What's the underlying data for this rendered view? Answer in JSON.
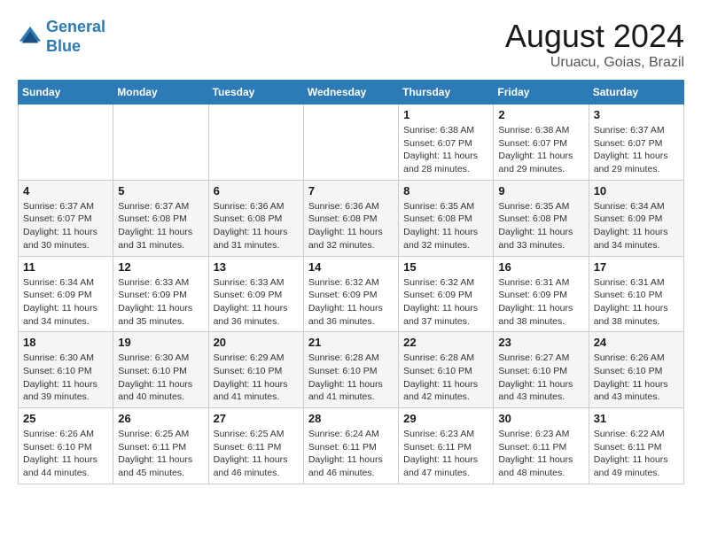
{
  "header": {
    "logo_line1": "General",
    "logo_line2": "Blue",
    "month_title": "August 2024",
    "subtitle": "Uruacu, Goias, Brazil"
  },
  "weekdays": [
    "Sunday",
    "Monday",
    "Tuesday",
    "Wednesday",
    "Thursday",
    "Friday",
    "Saturday"
  ],
  "weeks": [
    [
      {
        "day": "",
        "info": ""
      },
      {
        "day": "",
        "info": ""
      },
      {
        "day": "",
        "info": ""
      },
      {
        "day": "",
        "info": ""
      },
      {
        "day": "1",
        "info": "Sunrise: 6:38 AM\nSunset: 6:07 PM\nDaylight: 11 hours and 28 minutes."
      },
      {
        "day": "2",
        "info": "Sunrise: 6:38 AM\nSunset: 6:07 PM\nDaylight: 11 hours and 29 minutes."
      },
      {
        "day": "3",
        "info": "Sunrise: 6:37 AM\nSunset: 6:07 PM\nDaylight: 11 hours and 29 minutes."
      }
    ],
    [
      {
        "day": "4",
        "info": "Sunrise: 6:37 AM\nSunset: 6:07 PM\nDaylight: 11 hours and 30 minutes."
      },
      {
        "day": "5",
        "info": "Sunrise: 6:37 AM\nSunset: 6:08 PM\nDaylight: 11 hours and 31 minutes."
      },
      {
        "day": "6",
        "info": "Sunrise: 6:36 AM\nSunset: 6:08 PM\nDaylight: 11 hours and 31 minutes."
      },
      {
        "day": "7",
        "info": "Sunrise: 6:36 AM\nSunset: 6:08 PM\nDaylight: 11 hours and 32 minutes."
      },
      {
        "day": "8",
        "info": "Sunrise: 6:35 AM\nSunset: 6:08 PM\nDaylight: 11 hours and 32 minutes."
      },
      {
        "day": "9",
        "info": "Sunrise: 6:35 AM\nSunset: 6:08 PM\nDaylight: 11 hours and 33 minutes."
      },
      {
        "day": "10",
        "info": "Sunrise: 6:34 AM\nSunset: 6:09 PM\nDaylight: 11 hours and 34 minutes."
      }
    ],
    [
      {
        "day": "11",
        "info": "Sunrise: 6:34 AM\nSunset: 6:09 PM\nDaylight: 11 hours and 34 minutes."
      },
      {
        "day": "12",
        "info": "Sunrise: 6:33 AM\nSunset: 6:09 PM\nDaylight: 11 hours and 35 minutes."
      },
      {
        "day": "13",
        "info": "Sunrise: 6:33 AM\nSunset: 6:09 PM\nDaylight: 11 hours and 36 minutes."
      },
      {
        "day": "14",
        "info": "Sunrise: 6:32 AM\nSunset: 6:09 PM\nDaylight: 11 hours and 36 minutes."
      },
      {
        "day": "15",
        "info": "Sunrise: 6:32 AM\nSunset: 6:09 PM\nDaylight: 11 hours and 37 minutes."
      },
      {
        "day": "16",
        "info": "Sunrise: 6:31 AM\nSunset: 6:09 PM\nDaylight: 11 hours and 38 minutes."
      },
      {
        "day": "17",
        "info": "Sunrise: 6:31 AM\nSunset: 6:10 PM\nDaylight: 11 hours and 38 minutes."
      }
    ],
    [
      {
        "day": "18",
        "info": "Sunrise: 6:30 AM\nSunset: 6:10 PM\nDaylight: 11 hours and 39 minutes."
      },
      {
        "day": "19",
        "info": "Sunrise: 6:30 AM\nSunset: 6:10 PM\nDaylight: 11 hours and 40 minutes."
      },
      {
        "day": "20",
        "info": "Sunrise: 6:29 AM\nSunset: 6:10 PM\nDaylight: 11 hours and 41 minutes."
      },
      {
        "day": "21",
        "info": "Sunrise: 6:28 AM\nSunset: 6:10 PM\nDaylight: 11 hours and 41 minutes."
      },
      {
        "day": "22",
        "info": "Sunrise: 6:28 AM\nSunset: 6:10 PM\nDaylight: 11 hours and 42 minutes."
      },
      {
        "day": "23",
        "info": "Sunrise: 6:27 AM\nSunset: 6:10 PM\nDaylight: 11 hours and 43 minutes."
      },
      {
        "day": "24",
        "info": "Sunrise: 6:26 AM\nSunset: 6:10 PM\nDaylight: 11 hours and 43 minutes."
      }
    ],
    [
      {
        "day": "25",
        "info": "Sunrise: 6:26 AM\nSunset: 6:10 PM\nDaylight: 11 hours and 44 minutes."
      },
      {
        "day": "26",
        "info": "Sunrise: 6:25 AM\nSunset: 6:11 PM\nDaylight: 11 hours and 45 minutes."
      },
      {
        "day": "27",
        "info": "Sunrise: 6:25 AM\nSunset: 6:11 PM\nDaylight: 11 hours and 46 minutes."
      },
      {
        "day": "28",
        "info": "Sunrise: 6:24 AM\nSunset: 6:11 PM\nDaylight: 11 hours and 46 minutes."
      },
      {
        "day": "29",
        "info": "Sunrise: 6:23 AM\nSunset: 6:11 PM\nDaylight: 11 hours and 47 minutes."
      },
      {
        "day": "30",
        "info": "Sunrise: 6:23 AM\nSunset: 6:11 PM\nDaylight: 11 hours and 48 minutes."
      },
      {
        "day": "31",
        "info": "Sunrise: 6:22 AM\nSunset: 6:11 PM\nDaylight: 11 hours and 49 minutes."
      }
    ]
  ]
}
